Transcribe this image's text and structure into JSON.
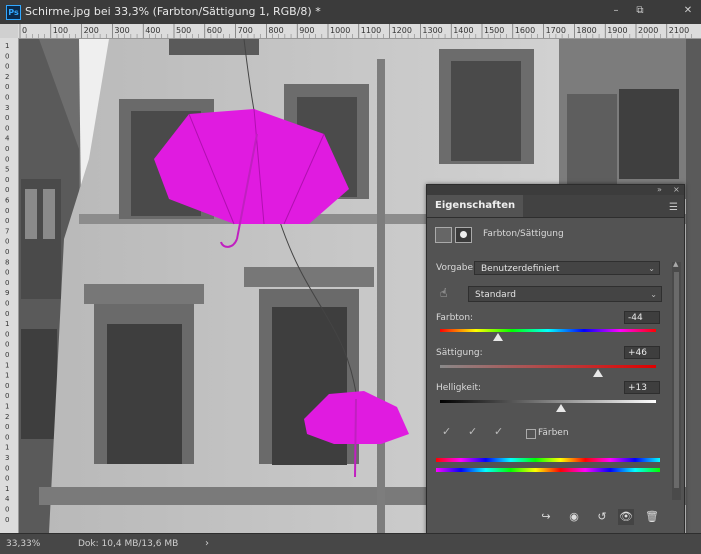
{
  "window": {
    "title": "Schirme.jpg bei 33,3% (Farbton/Sättigung 1, RGB/8) *",
    "app_icon": "Ps",
    "minimize": "–",
    "restore": "⧉",
    "close": "✕"
  },
  "ruler": {
    "top_labels": [
      "0",
      "100",
      "200",
      "300",
      "400",
      "500",
      "600",
      "700",
      "800",
      "900",
      "1000",
      "1100",
      "1200",
      "1300",
      "1400",
      "1500",
      "1600",
      "1700",
      "1800",
      "1900",
      "2000",
      "2100"
    ],
    "left_labels": [
      "1",
      "0",
      "0",
      "2",
      "0",
      "0",
      "3",
      "0",
      "0",
      "4",
      "0",
      "0",
      "5",
      "0",
      "0",
      "6",
      "0",
      "0",
      "7",
      "0",
      "0",
      "8",
      "0",
      "0",
      "9",
      "0",
      "0",
      "1",
      "0",
      "0",
      "0",
      "1",
      "1",
      "0",
      "0",
      "1",
      "2",
      "0",
      "0",
      "1",
      "3",
      "0",
      "0",
      "1",
      "4",
      "0",
      "0"
    ]
  },
  "properties_panel": {
    "tab_label": "Eigenschaften",
    "collapse_label": "»",
    "close_label": "×",
    "adjustment_label": "Farbton/Sättigung",
    "preset": {
      "label": "Vorgabe:",
      "value": "Benutzerdefiniert"
    },
    "channel": {
      "value": "Standard"
    },
    "hue": {
      "label": "Farbton:",
      "value": "-44",
      "fraction": 0.27
    },
    "saturation": {
      "label": "Sättigung:",
      "value": "+46",
      "fraction": 0.73
    },
    "lightness": {
      "label": "Helligkeit:",
      "value": "+13",
      "fraction": 0.56
    },
    "colorize": {
      "label": "Färben",
      "checked": false
    }
  },
  "status": {
    "zoom": "33,33%",
    "doc": "Dok: 10,4 MB/13,6 MB",
    "arrow": "›"
  },
  "colors": {
    "umbrella": "#e01be0",
    "panel_bg": "#535353",
    "chrome": "#3b3b3b"
  }
}
